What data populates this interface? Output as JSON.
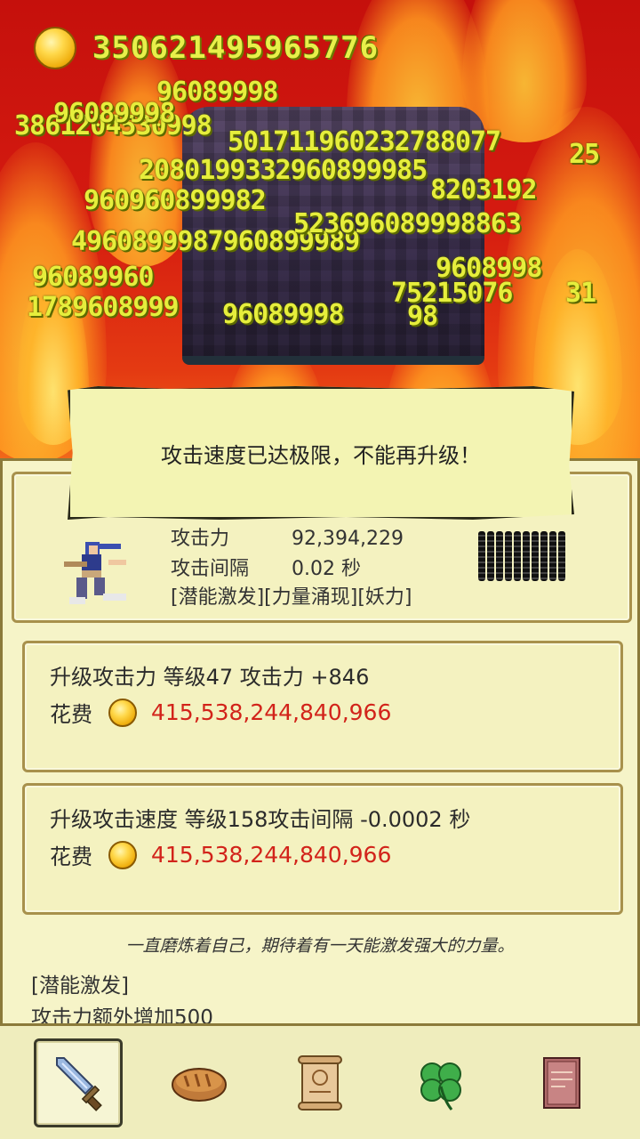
{
  "hud": {
    "gold_total": "350621495965776"
  },
  "damage_numbers": [
    "96089998",
    "3861204530998",
    "96089998",
    "501711960232788077",
    "25",
    "2080199332960899985",
    "960960899982",
    "8203192",
    "4960899987960899989",
    "523696089998863",
    "96089960",
    "9608998",
    "75215076",
    "31",
    "1789608999",
    "96089998",
    "98"
  ],
  "toast": {
    "message": "攻击速度已达极限，不能再升级！"
  },
  "hero": {
    "attack_label": "攻击力",
    "attack_value": "92,394,229",
    "interval_label": "攻击间隔",
    "interval_value": "0.02 秒",
    "buffs": "[潜能激发][力量涌现][妖力]"
  },
  "upgrades": [
    {
      "title": "升级攻击力 等级47      攻击力 +846",
      "cost_label": "花费",
      "cost_value": "415,538,244,840,966"
    },
    {
      "title": "升级攻击速度 等级158攻击间隔 -0.0002 秒",
      "cost_label": "花费",
      "cost_value": "415,538,244,840,966"
    }
  ],
  "flavor_text": "一直磨炼着自己，期待着有一天能激发强大的力量。",
  "skill": {
    "name": "[潜能激发]",
    "description": "攻击力额外增加500"
  },
  "tabs": [
    {
      "icon": "sword-icon",
      "active": true
    },
    {
      "icon": "bread-icon",
      "active": false
    },
    {
      "icon": "scroll-icon",
      "active": false
    },
    {
      "icon": "clover-icon",
      "active": false
    },
    {
      "icon": "book-icon",
      "active": false
    }
  ],
  "colors": {
    "cost_red": "#d2231a",
    "damage_yellow": "#e6ee3c",
    "panel_bg": "#f6f4c8"
  }
}
